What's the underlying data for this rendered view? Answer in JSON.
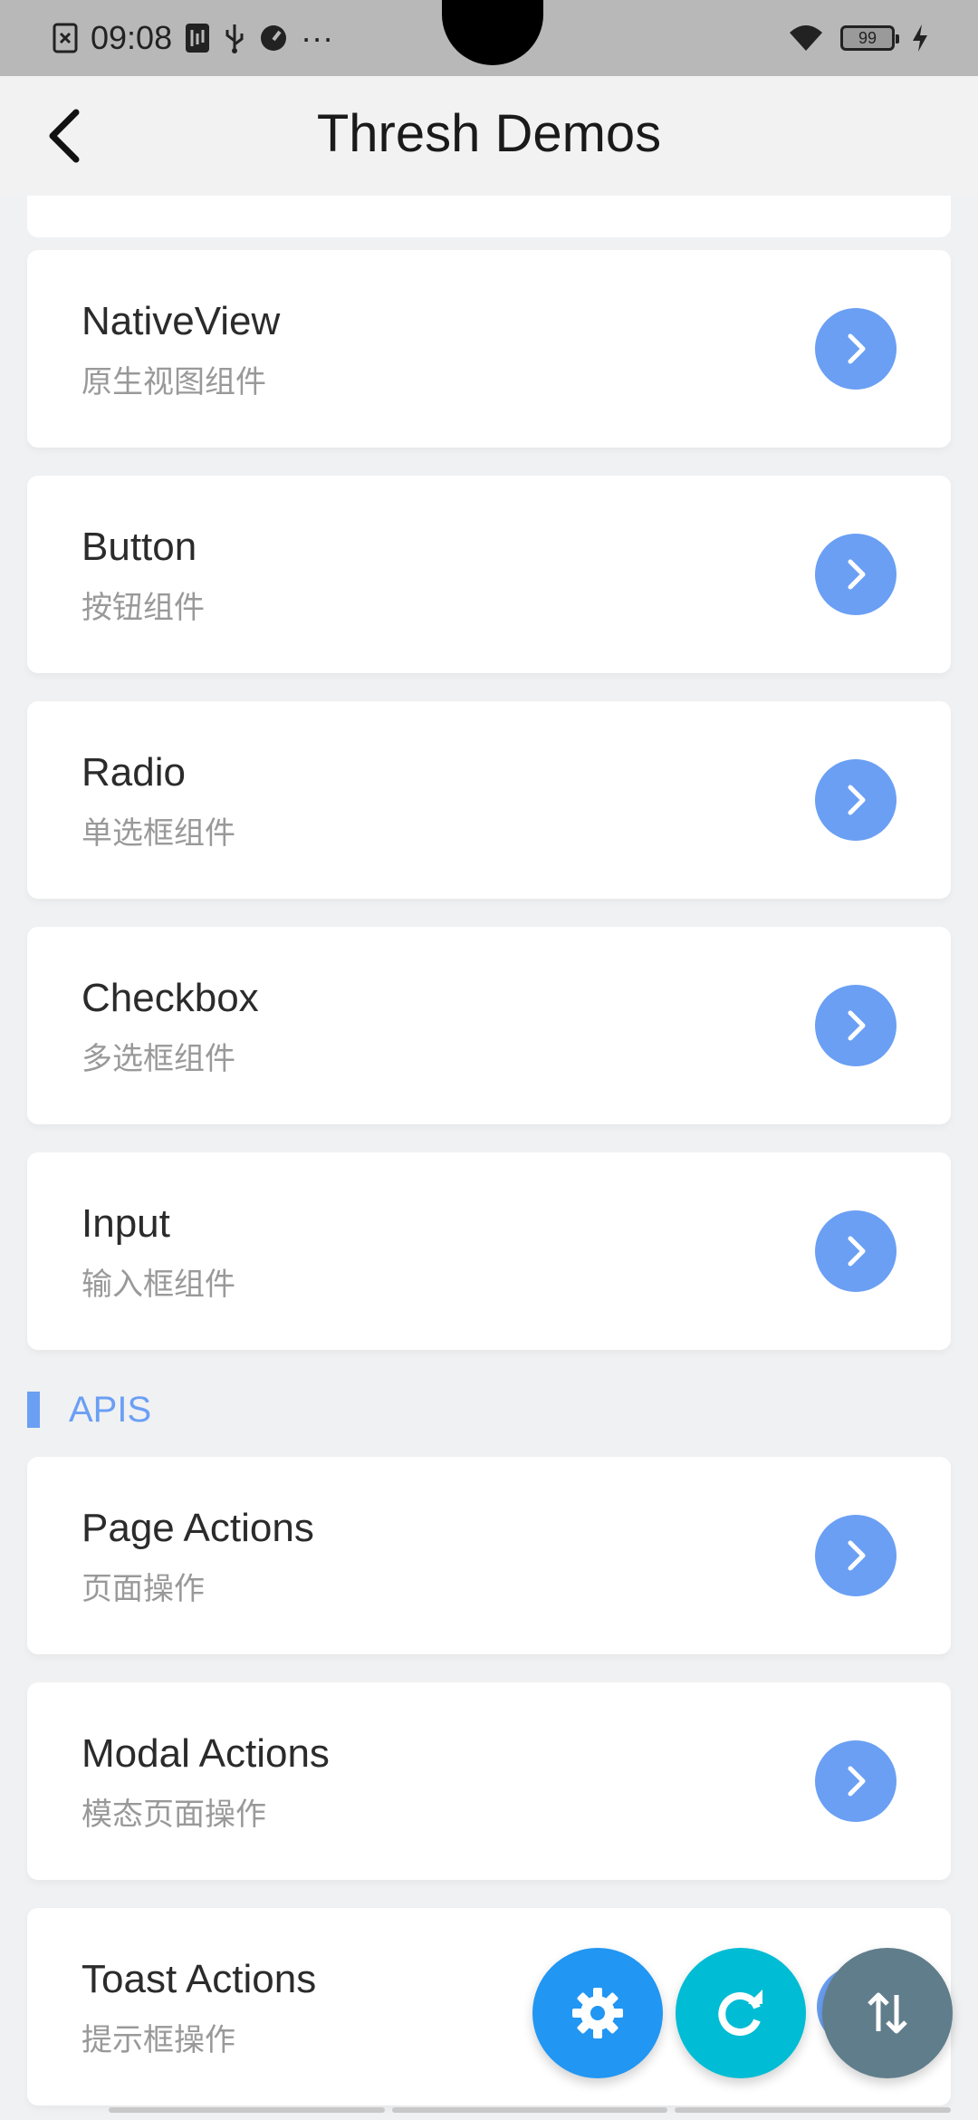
{
  "status_bar": {
    "time": "09:08",
    "battery": "99",
    "icons": [
      "screenshot-x-icon",
      "usb-debug-icon",
      "usb-icon",
      "speed-icon",
      "more-dots-icon",
      "wifi-icon",
      "battery-icon",
      "charging-icon"
    ],
    "more": "···"
  },
  "header": {
    "title": "Thresh Demos",
    "back_icon": "chevron-left-icon"
  },
  "components": [
    {
      "title": "NativeView",
      "subtitle": "原生视图组件"
    },
    {
      "title": "Button",
      "subtitle": "按钮组件"
    },
    {
      "title": "Radio",
      "subtitle": "单选框组件"
    },
    {
      "title": "Checkbox",
      "subtitle": "多选框组件"
    },
    {
      "title": "Input",
      "subtitle": "输入框组件"
    }
  ],
  "apis_section": {
    "label": "APIS"
  },
  "apis": [
    {
      "title": "Page Actions",
      "subtitle": "页面操作"
    },
    {
      "title": "Modal Actions",
      "subtitle": "模态页面操作"
    },
    {
      "title": "Toast Actions",
      "subtitle": "提示框操作"
    }
  ],
  "fabs": [
    {
      "icon": "gear-icon",
      "color": "#2196f3"
    },
    {
      "icon": "refresh-icon",
      "color": "#00bcd4"
    },
    {
      "icon": "sort-arrows-icon",
      "color": "#607d8b"
    }
  ],
  "colors": {
    "accent": "#6a9ff4",
    "background": "#f0f1f3",
    "card": "#ffffff",
    "title_text": "#2b2b2b",
    "subtitle_text": "#999999"
  }
}
